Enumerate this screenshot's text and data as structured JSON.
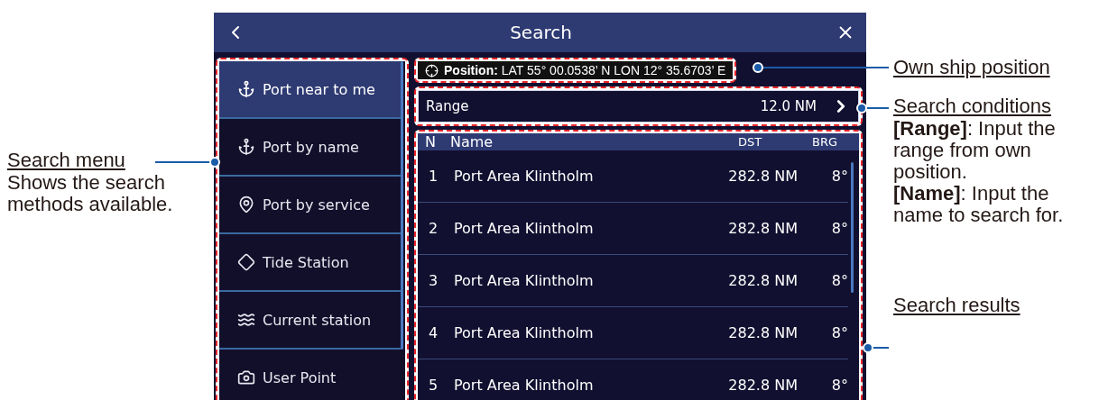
{
  "window": {
    "title": "Search"
  },
  "sidebar": {
    "items": [
      {
        "label": "Port near to me",
        "selected": true
      },
      {
        "label": "Port by name",
        "selected": false
      },
      {
        "label": "Port by service",
        "selected": false
      },
      {
        "label": "Tide Station",
        "selected": false
      },
      {
        "label": "Current station",
        "selected": false
      },
      {
        "label": "User Point",
        "selected": false
      }
    ]
  },
  "position": {
    "label": "Position:",
    "value": "LAT 55° 00.0538’ N  LON 12° 35.6703’ E"
  },
  "range": {
    "label": "Range",
    "value": "12.0 NM"
  },
  "results": {
    "columns": [
      "N",
      "Name",
      "DST",
      "BRG"
    ],
    "rows": [
      {
        "n": "1",
        "name": "Port Area Klintholm",
        "dst": "282.8 NM",
        "brg": "8°"
      },
      {
        "n": "2",
        "name": "Port Area Klintholm",
        "dst": "282.8 NM",
        "brg": "8°"
      },
      {
        "n": "3",
        "name": "Port Area Klintholm",
        "dst": "282.8 NM",
        "brg": "8°"
      },
      {
        "n": "4",
        "name": "Port Area Klintholm",
        "dst": "282.8 NM",
        "brg": "8°"
      },
      {
        "n": "5",
        "name": "Port Area Klintholm",
        "dst": "282.8 NM",
        "brg": "8°"
      }
    ]
  },
  "annotations": {
    "left": [
      {
        "title": "Search menu",
        "body": [
          "Shows the search methods available."
        ]
      }
    ],
    "right": [
      {
        "title": "Own ship position"
      },
      {
        "title": "Search conditions",
        "body": [
          "**[Range]**: Input the range from own position.",
          "**[Name]**: Input the name to search for."
        ]
      },
      {
        "title": "Search results"
      }
    ]
  }
}
